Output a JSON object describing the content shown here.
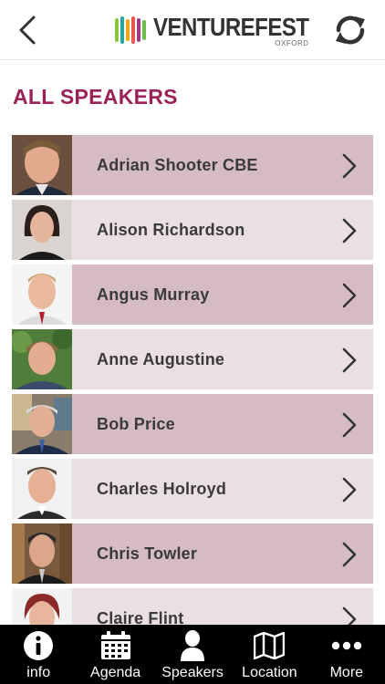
{
  "header": {
    "logo_word": "VENTUREFEST",
    "logo_sub": "OXFORD",
    "logo_colors": [
      "#8cc63f",
      "#2aa6a0",
      "#f3a712",
      "#e8584d",
      "#9b3b85",
      "#6cc04a"
    ]
  },
  "page": {
    "title": "ALL SPEAKERS"
  },
  "theme": {
    "accent": "#9a2257",
    "row_dark": "#d5bbc6",
    "row_light": "#eadfe4",
    "name_color": "#3a3a3a"
  },
  "speakers": [
    {
      "name": "Adrian Shooter CBE",
      "icon": "chevron-right-icon"
    },
    {
      "name": "Alison Richardson",
      "icon": "chevron-right-icon"
    },
    {
      "name": "Angus Murray",
      "icon": "chevron-right-icon"
    },
    {
      "name": "Anne Augustine",
      "icon": "chevron-right-icon"
    },
    {
      "name": "Bob Price",
      "icon": "chevron-right-icon"
    },
    {
      "name": "Charles Holroyd",
      "icon": "chevron-right-icon"
    },
    {
      "name": "Chris Towler",
      "icon": "chevron-right-icon"
    },
    {
      "name": "Claire Flint",
      "icon": "chevron-right-icon"
    }
  ],
  "tabs": [
    {
      "label": "info",
      "icon": "info-icon"
    },
    {
      "label": "Agenda",
      "icon": "calendar-icon"
    },
    {
      "label": "Speakers",
      "icon": "person-icon"
    },
    {
      "label": "Location",
      "icon": "map-icon"
    },
    {
      "label": "More",
      "icon": "more-icon"
    }
  ]
}
